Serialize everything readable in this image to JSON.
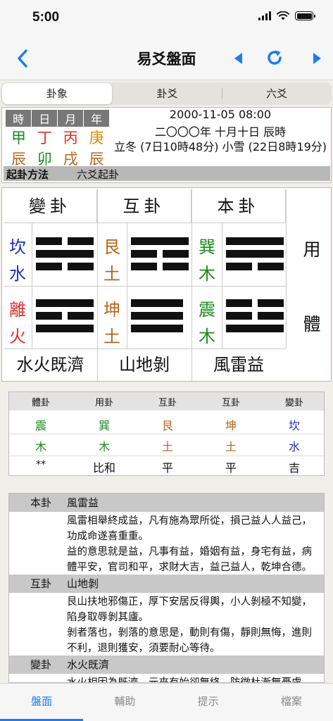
{
  "status": {
    "time": "5:00"
  },
  "nav": {
    "title": "易爻盤面"
  },
  "segments": [
    "卦象",
    "卦爻",
    "六爻"
  ],
  "pillars": {
    "headers": [
      "時",
      "日",
      "月",
      "年"
    ],
    "stems": [
      "甲",
      "丁",
      "丙",
      "庚"
    ],
    "branches": [
      "辰",
      "卯",
      "戌",
      "辰"
    ]
  },
  "date": {
    "gregorian": "2000-11-05 08:00",
    "lunar": "二〇〇〇年 十月十日 辰時",
    "solar_terms": "立冬 (7日10時48分) 小雪 (22日8時19分)"
  },
  "method": {
    "label": "起卦方法",
    "value": "六爻起卦"
  },
  "hexagrams": {
    "headers": [
      "變卦",
      "互卦",
      "本卦"
    ],
    "upper_chars": [
      [
        "坎",
        "水"
      ],
      [
        "艮",
        "土"
      ],
      [
        "巽",
        "木"
      ]
    ],
    "lower_chars": [
      [
        "離",
        "火"
      ],
      [
        "坤",
        "土"
      ],
      [
        "震",
        "木"
      ]
    ],
    "names": [
      "水火既濟",
      "山地剝",
      "風雷益"
    ],
    "side_labels": [
      "用",
      "體"
    ]
  },
  "summary": {
    "headers": [
      "體卦",
      "用卦",
      "互卦",
      "互卦",
      "變卦"
    ],
    "trigrams": [
      "震",
      "巽",
      "艮",
      "坤",
      "坎"
    ],
    "elements": [
      "木",
      "木",
      "土",
      "土",
      "水"
    ],
    "relations": [
      "**",
      "比和",
      "平",
      "平",
      "吉"
    ]
  },
  "descriptions": [
    {
      "label": "本卦",
      "name": "風雷益",
      "lines": [
        "風雷相舉終成益，凡有施為眾所從，損己益人人益己，",
        "功成命遂喜重重。",
        "益的意思就是益，凡事有益，婚姻有益，身宅有益，病",
        "體平安，官司和平，求財大吉，益己益人，乾坤合德。"
      ]
    },
    {
      "label": "互卦",
      "name": "山地剝",
      "lines": [
        "艮山扶地邪傷正，厚下安居反得輿，小人剝極不知變，",
        "陷身取辱剝其廬。",
        "剝者落也，剝落的意思是，動則有傷，靜則無悔，進則",
        "不利，退則獲安，須要耐心等待。"
      ]
    },
    {
      "label": "變卦",
      "name": "水火既濟",
      "lines": [
        "水火相因為既濟，元來有始卻無終，防微杜漸無憂慮，"
      ]
    }
  ],
  "tabs": [
    "盤面",
    "輔助",
    "提示",
    "檔案"
  ],
  "colors": {
    "accent": "#1a7cf5",
    "wood": "#1e8a1e",
    "fire": "#e0302a",
    "earth": "#b5651d",
    "metal": "#e08a00",
    "water": "#1f2fb8"
  }
}
